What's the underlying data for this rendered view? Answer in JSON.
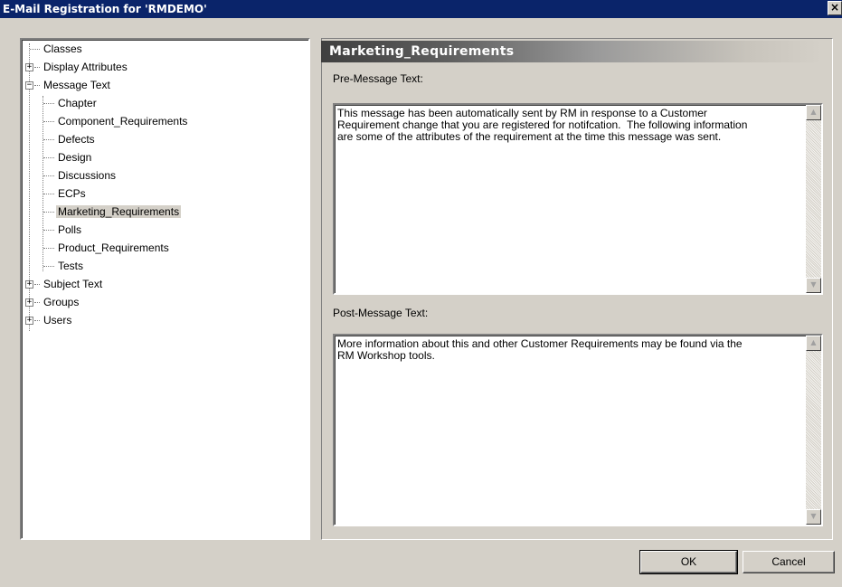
{
  "window": {
    "title": "E-Mail Registration for 'RMDEMO'",
    "close_glyph": "×"
  },
  "tree": {
    "items": [
      {
        "label": "Classes",
        "expander": "",
        "selected": false
      },
      {
        "label": "Display Attributes",
        "expander": "+",
        "selected": false
      },
      {
        "label": "Message Text",
        "expander": "−",
        "selected": false
      },
      {
        "label": "Chapter",
        "expander": "",
        "selected": false
      },
      {
        "label": "Component_Requirements",
        "expander": "",
        "selected": false
      },
      {
        "label": "Defects",
        "expander": "",
        "selected": false
      },
      {
        "label": "Design",
        "expander": "",
        "selected": false
      },
      {
        "label": "Discussions",
        "expander": "",
        "selected": false
      },
      {
        "label": "ECPs",
        "expander": "",
        "selected": false
      },
      {
        "label": "Marketing_Requirements",
        "expander": "",
        "selected": true
      },
      {
        "label": "Polls",
        "expander": "",
        "selected": false
      },
      {
        "label": "Product_Requirements",
        "expander": "",
        "selected": false
      },
      {
        "label": "Tests",
        "expander": "",
        "selected": false
      },
      {
        "label": "Subject Text",
        "expander": "+",
        "selected": false
      },
      {
        "label": "Groups",
        "expander": "+",
        "selected": false
      },
      {
        "label": "Users",
        "expander": "+",
        "selected": false
      }
    ]
  },
  "panel": {
    "header": "Marketing_Requirements",
    "pre_label": "Pre-Message Text:",
    "pre_text": "This message has been automatically sent by RM in response to a Customer\nRequirement change that you are registered for notifcation.  The following information\nare some of the attributes of the requirement at the time this message was sent.",
    "post_label": "Post-Message Text:",
    "post_text": "More information about this and other Customer Requirements may be found via the\nRM Workshop tools."
  },
  "buttons": {
    "ok": "OK",
    "cancel": "Cancel"
  },
  "icons": {
    "scroll_up": "▲",
    "scroll_down": "▼"
  }
}
